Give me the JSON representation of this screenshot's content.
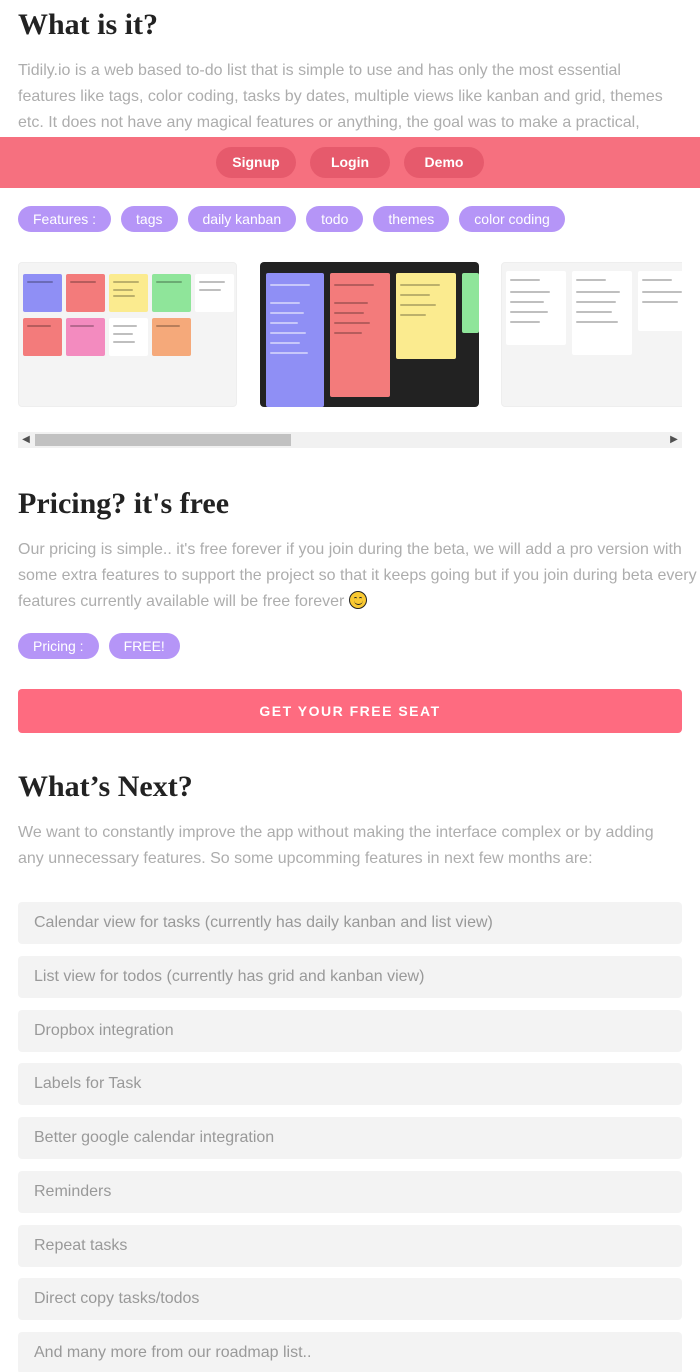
{
  "about": {
    "title": "What is it?",
    "text": "Tidily.io is a web based to-do list that is simple to use and has only the most essential features like tags, color coding, tasks by dates, multiple views like kanban and grid, themes etc. It does not have any magical features or anything, the goal was to make a practical,"
  },
  "nav": {
    "signup": "Signup",
    "login": "Login",
    "demo": "Demo"
  },
  "features": {
    "label": "Features :",
    "tags": [
      "tags",
      "daily kanban",
      "todo",
      "themes",
      "color coding"
    ]
  },
  "pricing": {
    "title": "Pricing? it's free",
    "text": "Our pricing is simple.. it's free forever if you join during the beta, we will add a pro version with some extra features to support the project so that it keeps going but if you join during beta every features currently available will be free forever",
    "label": "Pricing :",
    "value": "FREE!"
  },
  "cta": {
    "label": "GET YOUR FREE SEAT"
  },
  "next": {
    "title": "What’s Next?",
    "text": "We want to constantly improve the app without making the interface complex or by adding any unnecessary features. So some upcomming features in next few months are:",
    "items": [
      "Calendar view for tasks (currently has daily kanban and list view)",
      "List view for todos (currently has grid and kanban view)",
      "Dropbox integration",
      "Labels for Task",
      "Better google calendar integration",
      "Reminders",
      "Repeat tasks",
      "Direct copy tasks/todos",
      "And many more from our roadmap list.."
    ]
  },
  "colors": {
    "nav_bar": "#f6707f",
    "nav_button": "#e65a6c",
    "pill": "#b595f7",
    "cta": "#fe6b80",
    "list_bg": "#f3f3f3"
  },
  "icons": {
    "emoji": "smiling-face-icon",
    "scroll_left": "chevron-left-icon",
    "scroll_right": "chevron-right-icon"
  }
}
